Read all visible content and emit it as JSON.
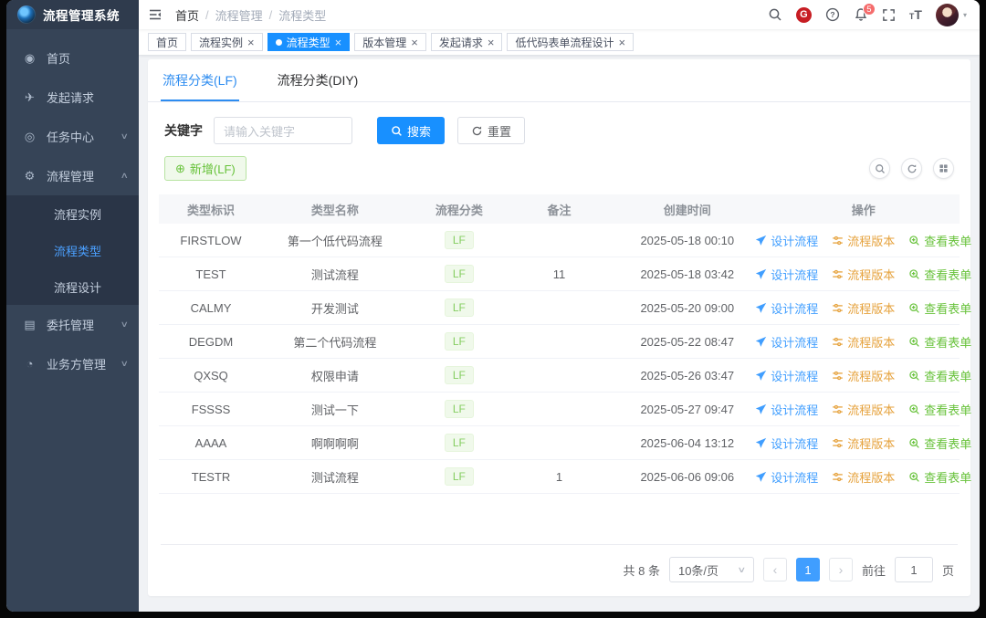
{
  "app": {
    "title": "流程管理系统"
  },
  "sidebar": {
    "menu_top": [
      {
        "icon": "dashboard-icon",
        "icon_glyph": "◉",
        "label": "首页"
      },
      {
        "icon": "paper-plane-icon",
        "icon_glyph": "✈",
        "label": "发起请求"
      },
      {
        "icon": "task-center-icon",
        "icon_glyph": "◎",
        "label": "任务中心",
        "chevron": "∨"
      },
      {
        "icon": "gear-icon",
        "icon_glyph": "⚙",
        "label": "流程管理",
        "chevron": "∧",
        "active": true
      }
    ],
    "submenu": [
      {
        "label": "流程实例"
      },
      {
        "label": "流程类型",
        "active": true
      },
      {
        "label": "流程设计"
      }
    ],
    "menu_bottom": [
      {
        "icon": "delegate-icon",
        "icon_glyph": "▤",
        "label": "委托管理",
        "chevron": "∨"
      },
      {
        "icon": "business-icon",
        "icon_glyph": "◔",
        "label": "业务方管理",
        "chevron": "∨"
      }
    ]
  },
  "header": {
    "breadcrumb": [
      "首页",
      "流程管理",
      "流程类型"
    ],
    "breadcrumb_separator": "/",
    "gitee_label": "G",
    "notification_count": "5",
    "font_size_icon": {
      "small": "T",
      "large": "T"
    },
    "avatar_caret": "▾"
  },
  "tags_view": {
    "close_glyph": "×",
    "tags": [
      {
        "label": "首页",
        "closable": false
      },
      {
        "label": "流程实例",
        "closable": true
      },
      {
        "label": "流程类型",
        "closable": true,
        "active": true
      },
      {
        "label": "版本管理",
        "closable": true
      },
      {
        "label": "发起请求",
        "closable": true
      },
      {
        "label": "低代码表单流程设计",
        "closable": true
      }
    ]
  },
  "main": {
    "tabs": [
      {
        "label": "流程分类(LF)",
        "active": true
      },
      {
        "label": "流程分类(DIY)",
        "active": false
      }
    ],
    "search": {
      "label": "关键字",
      "placeholder": "请输入关键字",
      "search_label": "搜索",
      "reset_label": "重置"
    },
    "add_button": {
      "icon_glyph": "⊕",
      "label": "新增(LF)"
    },
    "table": {
      "columns": [
        "类型标识",
        "类型名称",
        "流程分类",
        "备注",
        "创建时间",
        "操作"
      ],
      "actions": {
        "design": "设计流程",
        "version": "流程版本",
        "view_form": "查看表单"
      },
      "rows": [
        {
          "type_id": "FIRSTLOW",
          "type_name": "第一个低代码流程",
          "category": "LF",
          "remark": "",
          "created_at": "2025-05-18 00:10"
        },
        {
          "type_id": "TEST",
          "type_name": "测试流程",
          "category": "LF",
          "remark": "11",
          "created_at": "2025-05-18 03:42"
        },
        {
          "type_id": "CALMY",
          "type_name": "开发测试",
          "category": "LF",
          "remark": "",
          "created_at": "2025-05-20 09:00"
        },
        {
          "type_id": "DEGDM",
          "type_name": "第二个代码流程",
          "category": "LF",
          "remark": "",
          "created_at": "2025-05-22 08:47"
        },
        {
          "type_id": "QXSQ",
          "type_name": "权限申请",
          "category": "LF",
          "remark": "",
          "created_at": "2025-05-26 03:47"
        },
        {
          "type_id": "FSSSS",
          "type_name": "测试一下",
          "category": "LF",
          "remark": "",
          "created_at": "2025-05-27 09:47"
        },
        {
          "type_id": "AAAA",
          "type_name": "啊啊啊啊",
          "category": "LF",
          "remark": "",
          "created_at": "2025-06-04 13:12"
        },
        {
          "type_id": "TESTR",
          "type_name": "测试流程",
          "category": "LF",
          "remark": "1",
          "created_at": "2025-06-06 09:06"
        }
      ]
    },
    "pagination": {
      "total_label": "共 8 条",
      "page_size": "10条/页",
      "select_caret": "∨",
      "prev_glyph": "‹",
      "next_glyph": "›",
      "current_page": "1",
      "goto_label": "前往",
      "goto_value": "1",
      "page_unit": "页"
    }
  }
}
